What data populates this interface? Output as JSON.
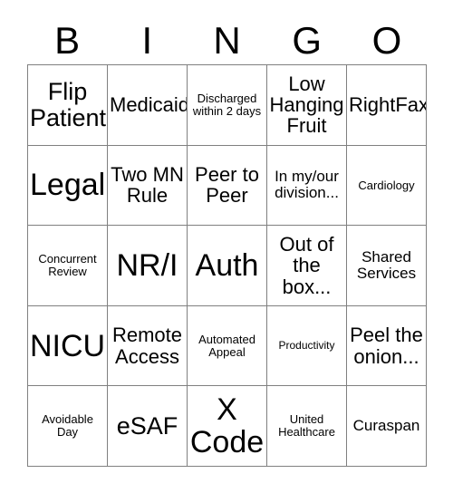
{
  "card": {
    "header_letters": [
      "B",
      "I",
      "N",
      "G",
      "O"
    ],
    "grid_size": "5x5",
    "colors": {
      "background": "#ffffff",
      "text": "#000000",
      "grid_line": "#808080"
    },
    "rows": [
      [
        {
          "text": "Flip Patient",
          "size": "lg"
        },
        {
          "text": "Medicaid",
          "size": "md"
        },
        {
          "text": "Discharged within 2 days",
          "size": "xs"
        },
        {
          "text": "Low Hanging Fruit",
          "size": "md"
        },
        {
          "text": "RightFax",
          "size": "md"
        }
      ],
      [
        {
          "text": "Legal",
          "size": "xl"
        },
        {
          "text": "Two MN Rule",
          "size": "md"
        },
        {
          "text": "Peer to Peer",
          "size": "md"
        },
        {
          "text": "In my/our division...",
          "size": "sm"
        },
        {
          "text": "Cardiology",
          "size": "xs"
        }
      ],
      [
        {
          "text": "Concurrent Review",
          "size": "xs"
        },
        {
          "text": "NR/I",
          "size": "xl"
        },
        {
          "text": "Auth",
          "size": "xl"
        },
        {
          "text": "Out of the box...",
          "size": "md"
        },
        {
          "text": "Shared Services",
          "size": "sm"
        }
      ],
      [
        {
          "text": "NICU",
          "size": "xl"
        },
        {
          "text": "Remote Access",
          "size": "md"
        },
        {
          "text": "Automated Appeal",
          "size": "xs"
        },
        {
          "text": "Productivity",
          "size": "xxs"
        },
        {
          "text": "Peel the onion...",
          "size": "md"
        }
      ],
      [
        {
          "text": "Avoidable Day",
          "size": "xs"
        },
        {
          "text": "eSAF",
          "size": "lg"
        },
        {
          "text": "X Code",
          "size": "xl"
        },
        {
          "text": "United Healthcare",
          "size": "xs"
        },
        {
          "text": "Curaspan",
          "size": "sm"
        }
      ]
    ]
  }
}
